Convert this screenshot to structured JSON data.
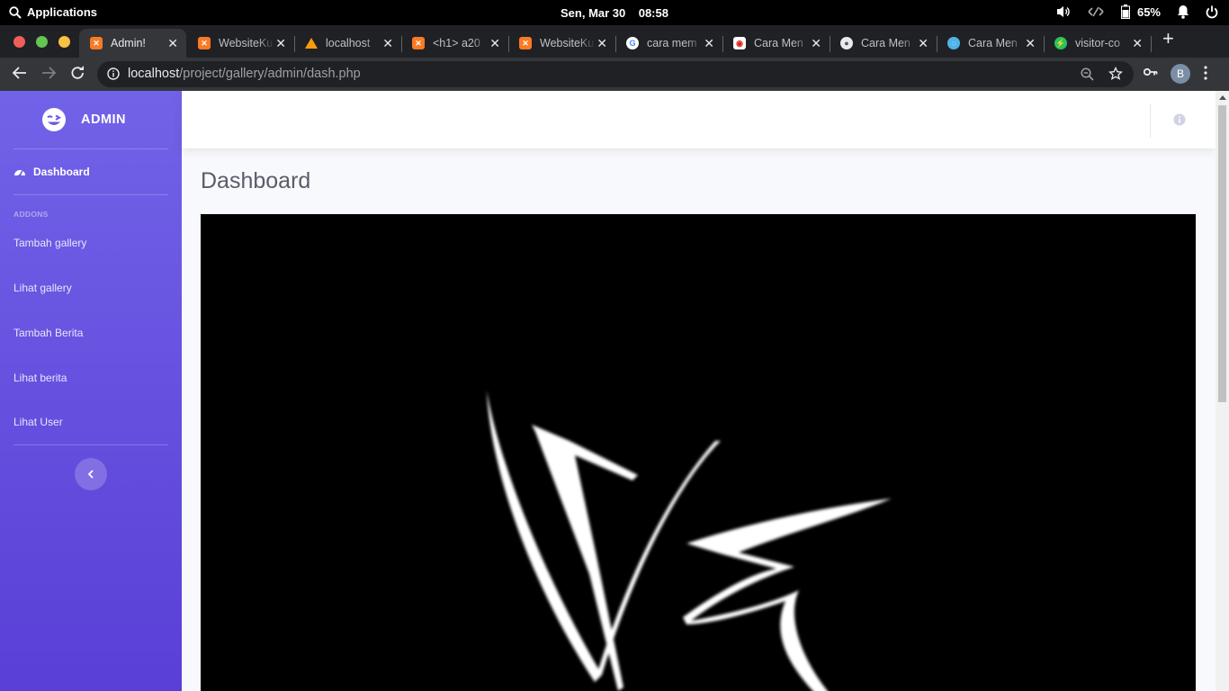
{
  "system_bar": {
    "applications_label": "Applications",
    "clock": "Sen, Mar 30    08:58",
    "battery_percent": "65%"
  },
  "browser": {
    "tabs": [
      {
        "title": "Admin!",
        "favicon": "xampp-icon",
        "active": true
      },
      {
        "title": "WebsiteKu",
        "favicon": "xampp-icon"
      },
      {
        "title": "localhost",
        "favicon": "phpmyadmin-icon"
      },
      {
        "title": "<h1> a20",
        "favicon": "xampp-icon"
      },
      {
        "title": "WebsiteKu",
        "favicon": "xampp-icon"
      },
      {
        "title": "cara mem",
        "favicon": "google-icon"
      },
      {
        "title": "Cara Men",
        "favicon": "red-site-icon"
      },
      {
        "title": "Cara Men",
        "favicon": "avatar-site-icon"
      },
      {
        "title": "Cara Men",
        "favicon": "blue-site-icon"
      },
      {
        "title": "visitor-co",
        "favicon": "green-bolt-icon"
      }
    ],
    "url_host": "localhost",
    "url_path": "/project/gallery/admin/dash.php",
    "profile_initial": "B"
  },
  "sidebar": {
    "brand": "ADMIN",
    "dashboard_label": "Dashboard",
    "heading": "ADDONS",
    "items": [
      {
        "label": "Tambah gallery"
      },
      {
        "label": "Lihat gallery"
      },
      {
        "label": "Tambah Berita"
      },
      {
        "label": "Lihat berita"
      },
      {
        "label": "Lihat User"
      }
    ]
  },
  "main": {
    "title": "Dashboard"
  },
  "colors": {
    "sidebar_top": "#7163e8",
    "sidebar_bottom": "#5a3fd6",
    "content_bg": "#f8f9fc",
    "title_text": "#5a5c69"
  }
}
